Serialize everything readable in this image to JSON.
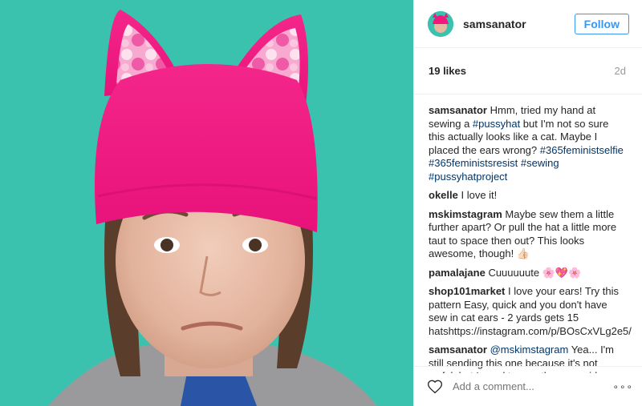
{
  "post": {
    "username": "samsanator",
    "follow_label": "Follow",
    "likes": "19 likes",
    "age": "2d"
  },
  "comments": [
    {
      "user": "samsanator",
      "parts": [
        {
          "t": " Hmm, tried my hand at sewing a "
        },
        {
          "t": "#pussyhat",
          "tag": true
        },
        {
          "t": " but I'm not so sure this actually looks like a cat. Maybe I placed the ears wrong? "
        },
        {
          "t": "#365feministselfie",
          "tag": true
        },
        {
          "t": " "
        },
        {
          "t": "#365feministsresist",
          "tag": true
        },
        {
          "t": " "
        },
        {
          "t": "#sewing",
          "tag": true
        },
        {
          "t": " "
        },
        {
          "t": "#pussyhatproject",
          "tag": true
        }
      ]
    },
    {
      "user": "okelle",
      "parts": [
        {
          "t": " I love it!"
        }
      ]
    },
    {
      "user": "mskimstagram",
      "parts": [
        {
          "t": " Maybe sew them a little further apart? Or pull the hat a little more taut to space then out? This looks awesome, though! 👍🏻"
        }
      ]
    },
    {
      "user": "pamalajane",
      "parts": [
        {
          "t": " Cuuuuuute 🌸💖🌸"
        }
      ]
    },
    {
      "user": "shop101market",
      "parts": [
        {
          "t": " I love your ears! Try this pattern Easy, quick and you don't have sew in cat ears - 2 yards gets 15 hatshttps://instagram.com/p/BOsCxVLg2e5/"
        }
      ]
    },
    {
      "user": "samsanator",
      "parts": [
        {
          "t": " "
        },
        {
          "t": "@mskimstagram",
          "tag": true
        },
        {
          "t": " Yea... I'm still sending this one because it's not awful, but I need to sew the ears wider on future ones"
        }
      ]
    }
  ],
  "footer": {
    "add_comment_placeholder": "Add a comment...",
    "more_label": "∘∘∘",
    "like_icon": "heart-outline-icon"
  },
  "colors": {
    "background": "#38c1ad",
    "hat": "#f0177f",
    "link": "#003569",
    "follow": "#3897f0"
  }
}
